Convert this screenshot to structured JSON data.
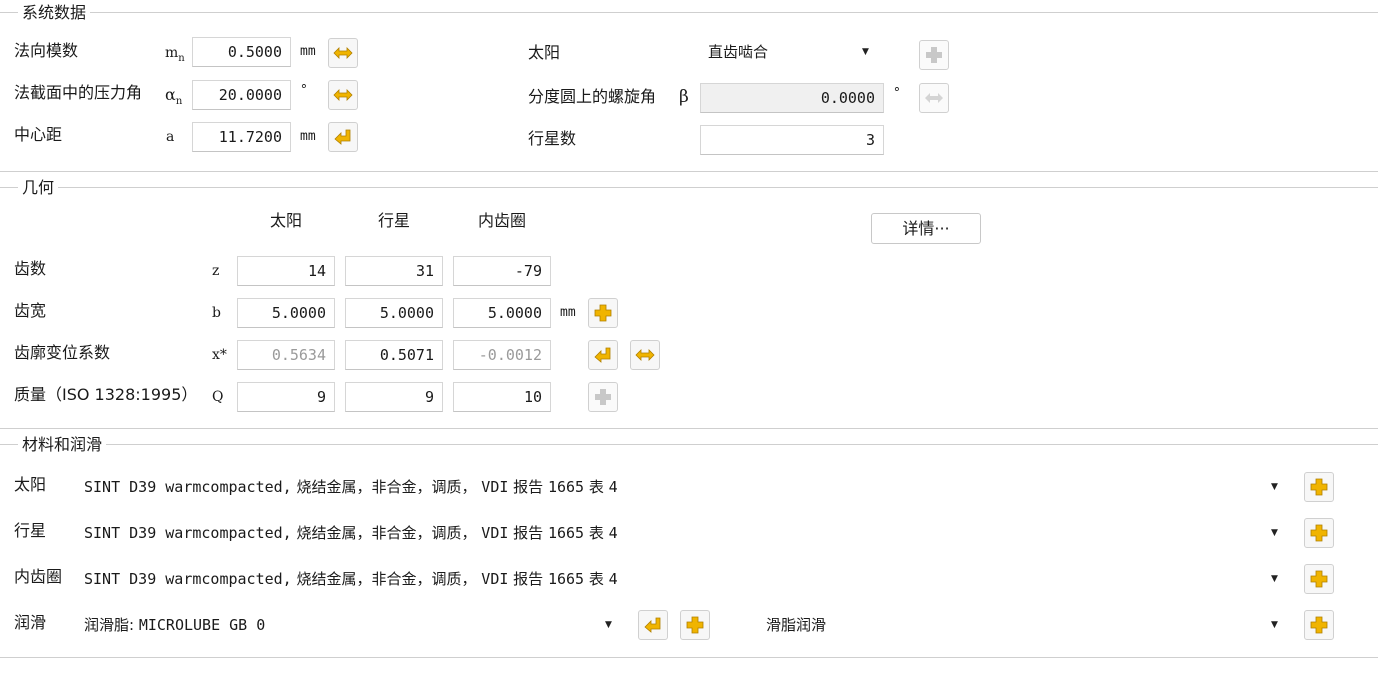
{
  "system": {
    "title": "系统数据",
    "normal_module": {
      "label": "法向模数",
      "symbol": "m",
      "sub": "n",
      "value": "0.5000",
      "unit": "mm"
    },
    "pressure_angle": {
      "label": "法截面中的压力角",
      "symbol": "α",
      "sub": "n",
      "value": "20.0000",
      "unit": "°"
    },
    "center_distance": {
      "label": "中心距",
      "symbol": "a",
      "value": "11.7200",
      "unit": "mm"
    },
    "sun": {
      "label": "太阳",
      "select": "直齿啮合"
    },
    "helix_angle": {
      "label": "分度圆上的螺旋角",
      "symbol": "β",
      "value": "0.0000",
      "unit": "°"
    },
    "planets": {
      "label": "行星数",
      "value": "3"
    }
  },
  "geometry": {
    "title": "几何",
    "columns": [
      "太阳",
      "行星",
      "内齿圈"
    ],
    "details_label": "详情···",
    "rows": [
      {
        "label": "齿数",
        "symbol": "z",
        "values": [
          "14",
          "31",
          "-79"
        ],
        "unit": ""
      },
      {
        "label": "齿宽",
        "symbol": "b",
        "values": [
          "5.0000",
          "5.0000",
          "5.0000"
        ],
        "unit": "mm"
      },
      {
        "label": "齿廓变位系数",
        "symbol": "x*",
        "values": [
          "0.5634",
          "0.5071",
          "-0.0012"
        ],
        "unit": ""
      },
      {
        "label": "质量（ISO 1328:1995）",
        "symbol": "Q",
        "values": [
          "9",
          "9",
          "10"
        ],
        "unit": ""
      }
    ]
  },
  "materials": {
    "title": "材料和润滑",
    "rows": [
      {
        "label": "太阳",
        "mono": "SINT D39 warmcompacted,",
        "text": "烧结金属，非合金，调质，",
        "mono2": "VDI",
        "text2": "报告",
        "mono3": "1665",
        "text3": "表",
        "mono4": "4"
      },
      {
        "label": "行星",
        "mono": "SINT D39 warmcompacted,",
        "text": "烧结金属，非合金，调质，",
        "mono2": "VDI",
        "text2": "报告",
        "mono3": "1665",
        "text3": "表",
        "mono4": "4"
      },
      {
        "label": "内齿圈",
        "mono": "SINT D39 warmcompacted,",
        "text": "烧结金属，非合金，调质，",
        "mono2": "VDI",
        "text2": "报告",
        "mono3": "1665",
        "text3": "表",
        "mono4": "4"
      }
    ],
    "lubrication": {
      "label": "润滑",
      "lubricant_prefix": "润滑脂:",
      "lubricant_name": "MICROLUBE GB 0",
      "type": "滑脂润滑"
    }
  },
  "colors": {
    "icon_yellow": "#f0b400",
    "icon_grey": "#c8c8c8",
    "border": "#cfcfcf"
  }
}
